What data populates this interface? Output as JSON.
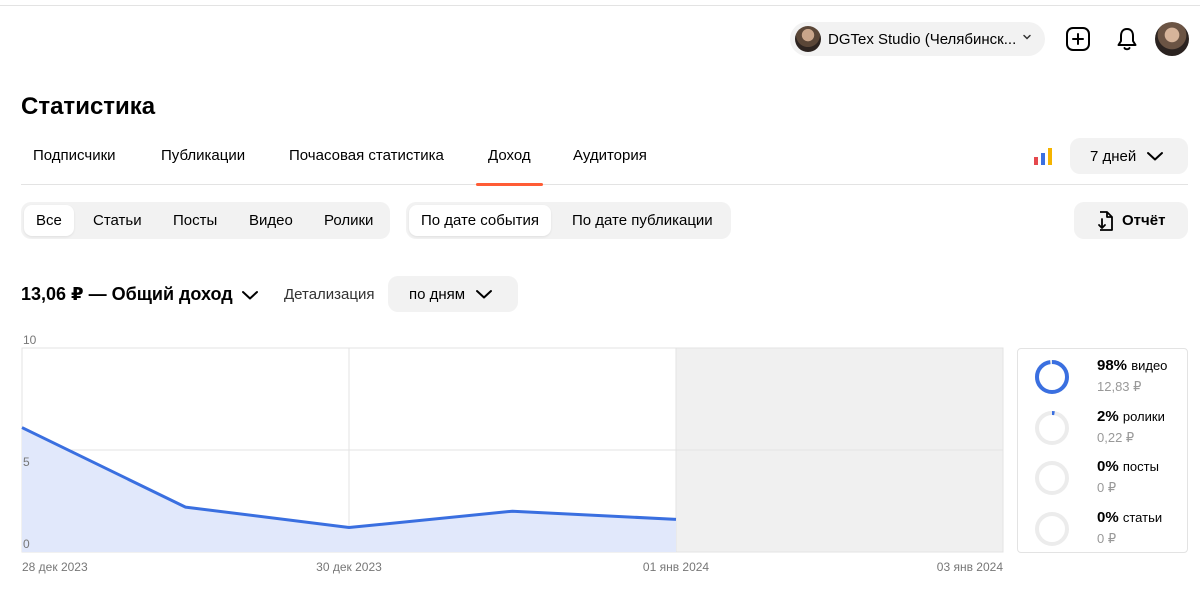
{
  "header": {
    "account_name": "DGTex Studio (Челябинск...",
    "avatar": "user-avatar"
  },
  "page": {
    "title": "Статистика"
  },
  "tabs": [
    {
      "label": "Подписчики"
    },
    {
      "label": "Публикации"
    },
    {
      "label": "Почасовая статистика"
    },
    {
      "label": "Доход",
      "active": true
    },
    {
      "label": "Аудитория"
    }
  ],
  "period": {
    "label": "7 дней"
  },
  "content_filter": [
    "Все",
    "Статьи",
    "Посты",
    "Видео",
    "Ролики"
  ],
  "content_filter_selected": "Все",
  "date_filter": [
    "По дате события",
    "По дате публикации"
  ],
  "date_filter_selected": "По дате события",
  "report_button": "Отчёт",
  "summary": {
    "total_label": "13,06 ₽ — Общий доход",
    "detail_label": "Детализация",
    "detail_value": "по дням"
  },
  "colors": {
    "accent": "#ff5c35",
    "line": "#3a6fe0",
    "area": "#e1e8fb",
    "future_area": "#f0f0f0"
  },
  "chart_data": {
    "type": "area",
    "x_ticks": [
      "28 дек 2023",
      "30 дек 2023",
      "01 янв 2024",
      "03 янв 2024"
    ],
    "y_ticks": [
      "10",
      "5",
      "0"
    ],
    "ylim": [
      0,
      10
    ],
    "x": [
      "28 дек 2023",
      "29 дек 2023",
      "30 дек 2023",
      "31 дек 2023",
      "01 янв 2024"
    ],
    "values": [
      6.1,
      2.2,
      1.2,
      2.0,
      1.6
    ],
    "future_range": [
      "01 янв 2024",
      "03 янв 2024"
    ],
    "grid": true
  },
  "legend": [
    {
      "pct": "98%",
      "name": "видео",
      "value": "12,83 ₽",
      "share": 0.98
    },
    {
      "pct": "2%",
      "name": "ролики",
      "value": "0,22 ₽",
      "share": 0.02
    },
    {
      "pct": "0%",
      "name": "посты",
      "value": "0 ₽",
      "share": 0
    },
    {
      "pct": "0%",
      "name": "статьи",
      "value": "0 ₽",
      "share": 0
    }
  ]
}
